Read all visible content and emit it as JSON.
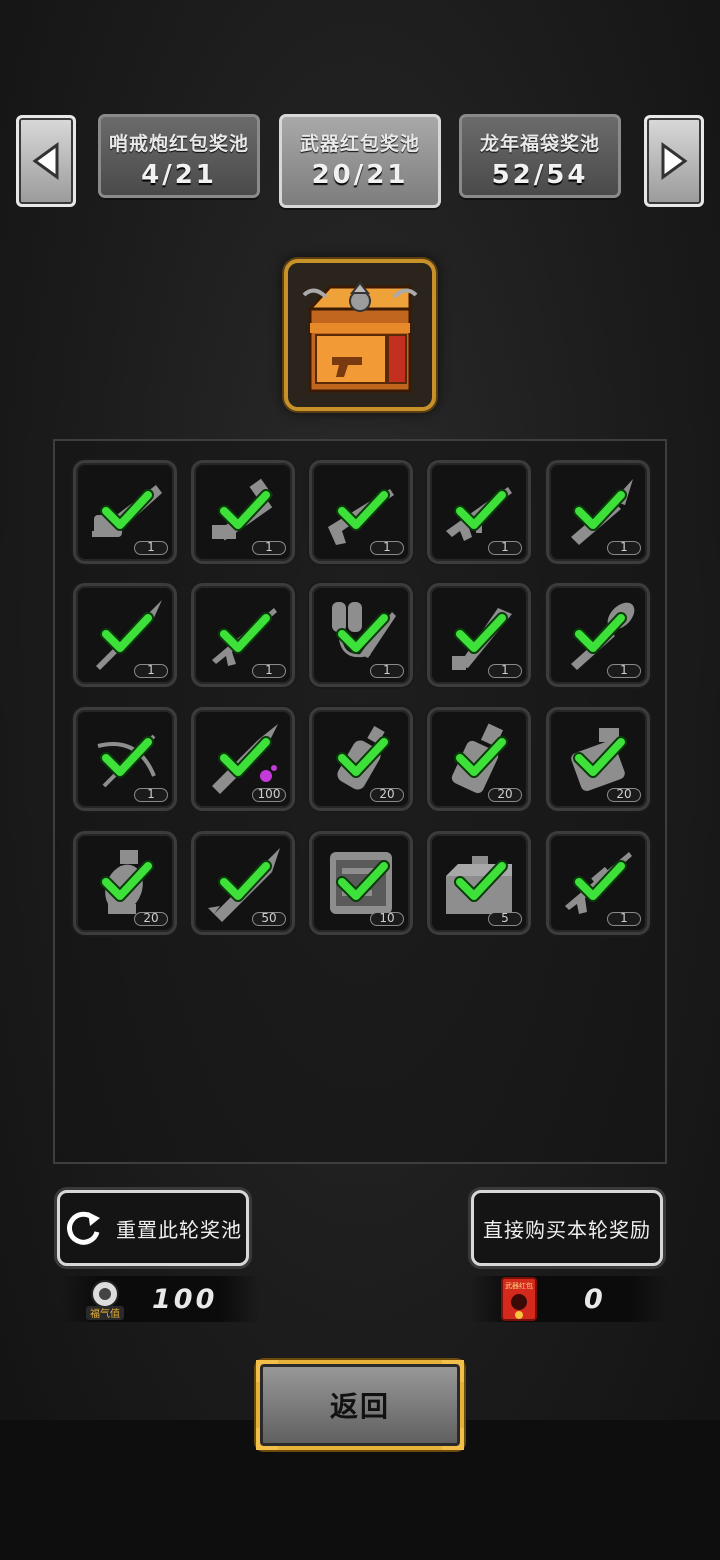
{
  "tabs": [
    {
      "title": "哨戒炮红包奖池",
      "count": "4/21",
      "active": false
    },
    {
      "title": "武器红包奖池",
      "count": "20/21",
      "active": true
    },
    {
      "title": "龙年福袋奖池",
      "count": "52/54",
      "active": false
    }
  ],
  "items": [
    {
      "icon": "chainsaw-icon",
      "qty": "1",
      "collected": true
    },
    {
      "icon": "minigun-icon",
      "qty": "1",
      "collected": true
    },
    {
      "icon": "shotgun-icon",
      "qty": "1",
      "collected": true
    },
    {
      "icon": "assault-rifle-icon",
      "qty": "1",
      "collected": true
    },
    {
      "icon": "combat-knife-icon",
      "qty": "1",
      "collected": true
    },
    {
      "icon": "spear-icon",
      "qty": "1",
      "collected": true
    },
    {
      "icon": "rifle-icon",
      "qty": "1",
      "collected": true
    },
    {
      "icon": "flamethrower-icon",
      "qty": "1",
      "collected": true
    },
    {
      "icon": "machete-icon",
      "qty": "1",
      "collected": true
    },
    {
      "icon": "shovel-icon",
      "qty": "1",
      "collected": true
    },
    {
      "icon": "crossbow-icon",
      "qty": "1",
      "collected": true
    },
    {
      "icon": "incendiary-bullet-icon",
      "qty": "100",
      "collected": true
    },
    {
      "icon": "smoke-grenade-icon",
      "qty": "20",
      "collected": true
    },
    {
      "icon": "frag-grenade-icon",
      "qty": "20",
      "collected": true
    },
    {
      "icon": "explosive-pack-icon",
      "qty": "20",
      "collected": true
    },
    {
      "icon": "grenade-icon",
      "qty": "20",
      "collected": true
    },
    {
      "icon": "rocket-icon",
      "qty": "50",
      "collected": true
    },
    {
      "icon": "toolbox-case-icon",
      "qty": "10",
      "collected": true
    },
    {
      "icon": "tool-chest-icon",
      "qty": "5",
      "collected": true
    },
    {
      "icon": "sniper-rifle-icon",
      "qty": "1",
      "collected": true
    }
  ],
  "actions": {
    "reset_label": "重置此轮奖池",
    "buy_label": "直接购买本轮奖励"
  },
  "currencies": {
    "luck_value": "100",
    "luck_icon_text": "福气值",
    "redpacket_value": "0",
    "redpacket_icon_text": "武器红包"
  },
  "return_label": "返回",
  "colors": {
    "check_green": "#3ee03a",
    "gold_frame": "#e7b23a",
    "chest_orange": "#e28a2b"
  }
}
